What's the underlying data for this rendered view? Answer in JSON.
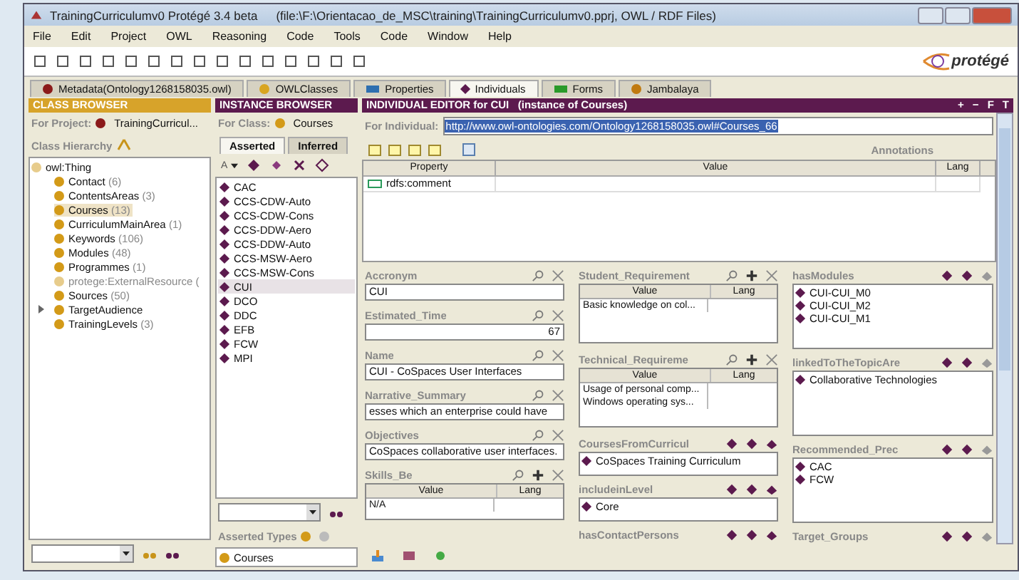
{
  "window": {
    "app": "TrainingCurriculumv0  Protégé 3.4 beta",
    "file": "(file:\\F:\\Orientacao_de_MSC\\training\\TrainingCurriculumv0.pprj, OWL / RDF Files)"
  },
  "menu": [
    "File",
    "Edit",
    "Project",
    "OWL",
    "Reasoning",
    "Code",
    "Tools",
    "Code",
    "Window",
    "Help"
  ],
  "logo": "protégé",
  "tabs": [
    {
      "label": "Metadata(Ontology1268158035.owl)",
      "kind": "metadata",
      "selected": false
    },
    {
      "label": "OWLClasses",
      "kind": "class",
      "selected": false
    },
    {
      "label": "Properties",
      "kind": "property",
      "selected": false
    },
    {
      "label": "Individuals",
      "kind": "individual",
      "selected": true
    },
    {
      "label": "Forms",
      "kind": "forms",
      "selected": false
    },
    {
      "label": "Jambalaya",
      "kind": "jambalaya",
      "selected": false
    }
  ],
  "class_browser": {
    "header": "CLASS BROWSER",
    "for_label": "For Project:",
    "project": "TrainingCurricul...",
    "hierarchy_label": "Class Hierarchy",
    "tree": {
      "label": "owl:Thing",
      "children": [
        {
          "label": "Contact",
          "count": "(6)",
          "selected": false,
          "collapsed": false,
          "dimmed": false
        },
        {
          "label": "ContentsAreas",
          "count": "(3)",
          "selected": false,
          "collapsed": false,
          "dimmed": false
        },
        {
          "label": "Courses",
          "count": "(13)",
          "selected": true,
          "collapsed": false,
          "dimmed": false
        },
        {
          "label": "CurriculumMainArea",
          "count": "(1)",
          "selected": false,
          "collapsed": false,
          "dimmed": false
        },
        {
          "label": "Keywords",
          "count": "(106)",
          "selected": false,
          "collapsed": false,
          "dimmed": false
        },
        {
          "label": "Modules",
          "count": "(48)",
          "selected": false,
          "collapsed": false,
          "dimmed": false
        },
        {
          "label": "Programmes",
          "count": "(1)",
          "selected": false,
          "collapsed": false,
          "dimmed": false
        },
        {
          "label": "protege:ExternalResource",
          "count": "(",
          "selected": false,
          "collapsed": false,
          "dimmed": true
        },
        {
          "label": "Sources",
          "count": "(50)",
          "selected": false,
          "collapsed": false,
          "dimmed": false
        },
        {
          "label": "TargetAudience",
          "selected": false,
          "collapsed": true,
          "dimmed": false
        },
        {
          "label": "TrainingLevels",
          "count": "(3)",
          "selected": false,
          "collapsed": false,
          "dimmed": false
        }
      ]
    }
  },
  "instance_browser": {
    "header": "INSTANCE BROWSER",
    "for_label": "For Class:",
    "class_name": "Courses",
    "tabs": [
      {
        "label": "Asserted",
        "selected": true
      },
      {
        "label": "Inferred",
        "selected": false
      }
    ],
    "sort_label": "A",
    "instances": [
      {
        "label": "CAC",
        "selected": false
      },
      {
        "label": "CCS-CDW-Auto",
        "selected": false
      },
      {
        "label": "CCS-CDW-Cons",
        "selected": false
      },
      {
        "label": "CCS-DDW-Aero",
        "selected": false
      },
      {
        "label": "CCS-DDW-Auto",
        "selected": false
      },
      {
        "label": "CCS-MSW-Aero",
        "selected": false
      },
      {
        "label": "CCS-MSW-Cons",
        "selected": false
      },
      {
        "label": "CUI",
        "selected": true
      },
      {
        "label": "DCO",
        "selected": false
      },
      {
        "label": "DDC",
        "selected": false
      },
      {
        "label": "EFB",
        "selected": false
      },
      {
        "label": "FCW",
        "selected": false
      },
      {
        "label": "MPI",
        "selected": false
      }
    ],
    "asserted_types_label": "Asserted Types",
    "asserted_types": [
      "Courses"
    ]
  },
  "editor": {
    "header": "INDIVIDUAL EDITOR for CUI",
    "header_note": "(instance of Courses)",
    "header_buttons": [
      "+",
      "−",
      "F",
      "T"
    ],
    "for_label": "For Individual:",
    "uri": "http://www.owl-ontologies.com/Ontology1268158035.owl#Courses_66",
    "annotations_label": "Annotations",
    "annotations": {
      "columns": [
        "Property",
        "Value",
        "Lang"
      ],
      "rows": [
        {
          "property": "rdfs:comment"
        }
      ]
    },
    "columns": [
      [
        {
          "kind": "text",
          "label": "Accronym",
          "value": "CUI"
        },
        {
          "kind": "number",
          "label": "Estimated_Time",
          "value": "67"
        },
        {
          "kind": "text",
          "label": "Name",
          "value": "CUI - CoSpaces User Interfaces"
        },
        {
          "kind": "text",
          "label": "Narrative_Summary",
          "value": "esses which an enterprise could have"
        },
        {
          "kind": "text",
          "label": "Objectives",
          "value": "CoSpaces collaborative user interfaces."
        },
        {
          "kind": "table",
          "label": "Skills_Be",
          "columns": [
            "Value",
            "Lang"
          ],
          "rows": [
            "N/A"
          ]
        }
      ],
      [
        {
          "kind": "table",
          "label": "Student_Requirement",
          "columns": [
            "Value",
            "Lang"
          ],
          "rows": [
            "Basic knowledge on col..."
          ]
        },
        {
          "kind": "table",
          "label": "Technical_Requireme",
          "columns": [
            "Value",
            "Lang"
          ],
          "rows": [
            "Usage of personal comp...",
            "Windows operating sys..."
          ]
        },
        {
          "kind": "list",
          "label": "CoursesFromCurricul",
          "items": [
            "CoSpaces Training Curriculum"
          ]
        },
        {
          "kind": "list",
          "label": "includeinLevel",
          "items": [
            "Core"
          ]
        },
        {
          "kind": "header",
          "label": "hasContactPersons"
        }
      ],
      [
        {
          "kind": "list",
          "label": "hasModules",
          "items": [
            "CUI-CUI_M0",
            "CUI-CUI_M2",
            "CUI-CUI_M1"
          ]
        },
        {
          "kind": "list",
          "label": "linkedToTheTopicAre",
          "items": [
            "Collaborative Technologies"
          ]
        },
        {
          "kind": "list",
          "label": "Recommended_Prec",
          "items": [
            "CAC",
            "FCW"
          ]
        },
        {
          "kind": "header",
          "label": "Target_Groups"
        }
      ]
    ]
  }
}
